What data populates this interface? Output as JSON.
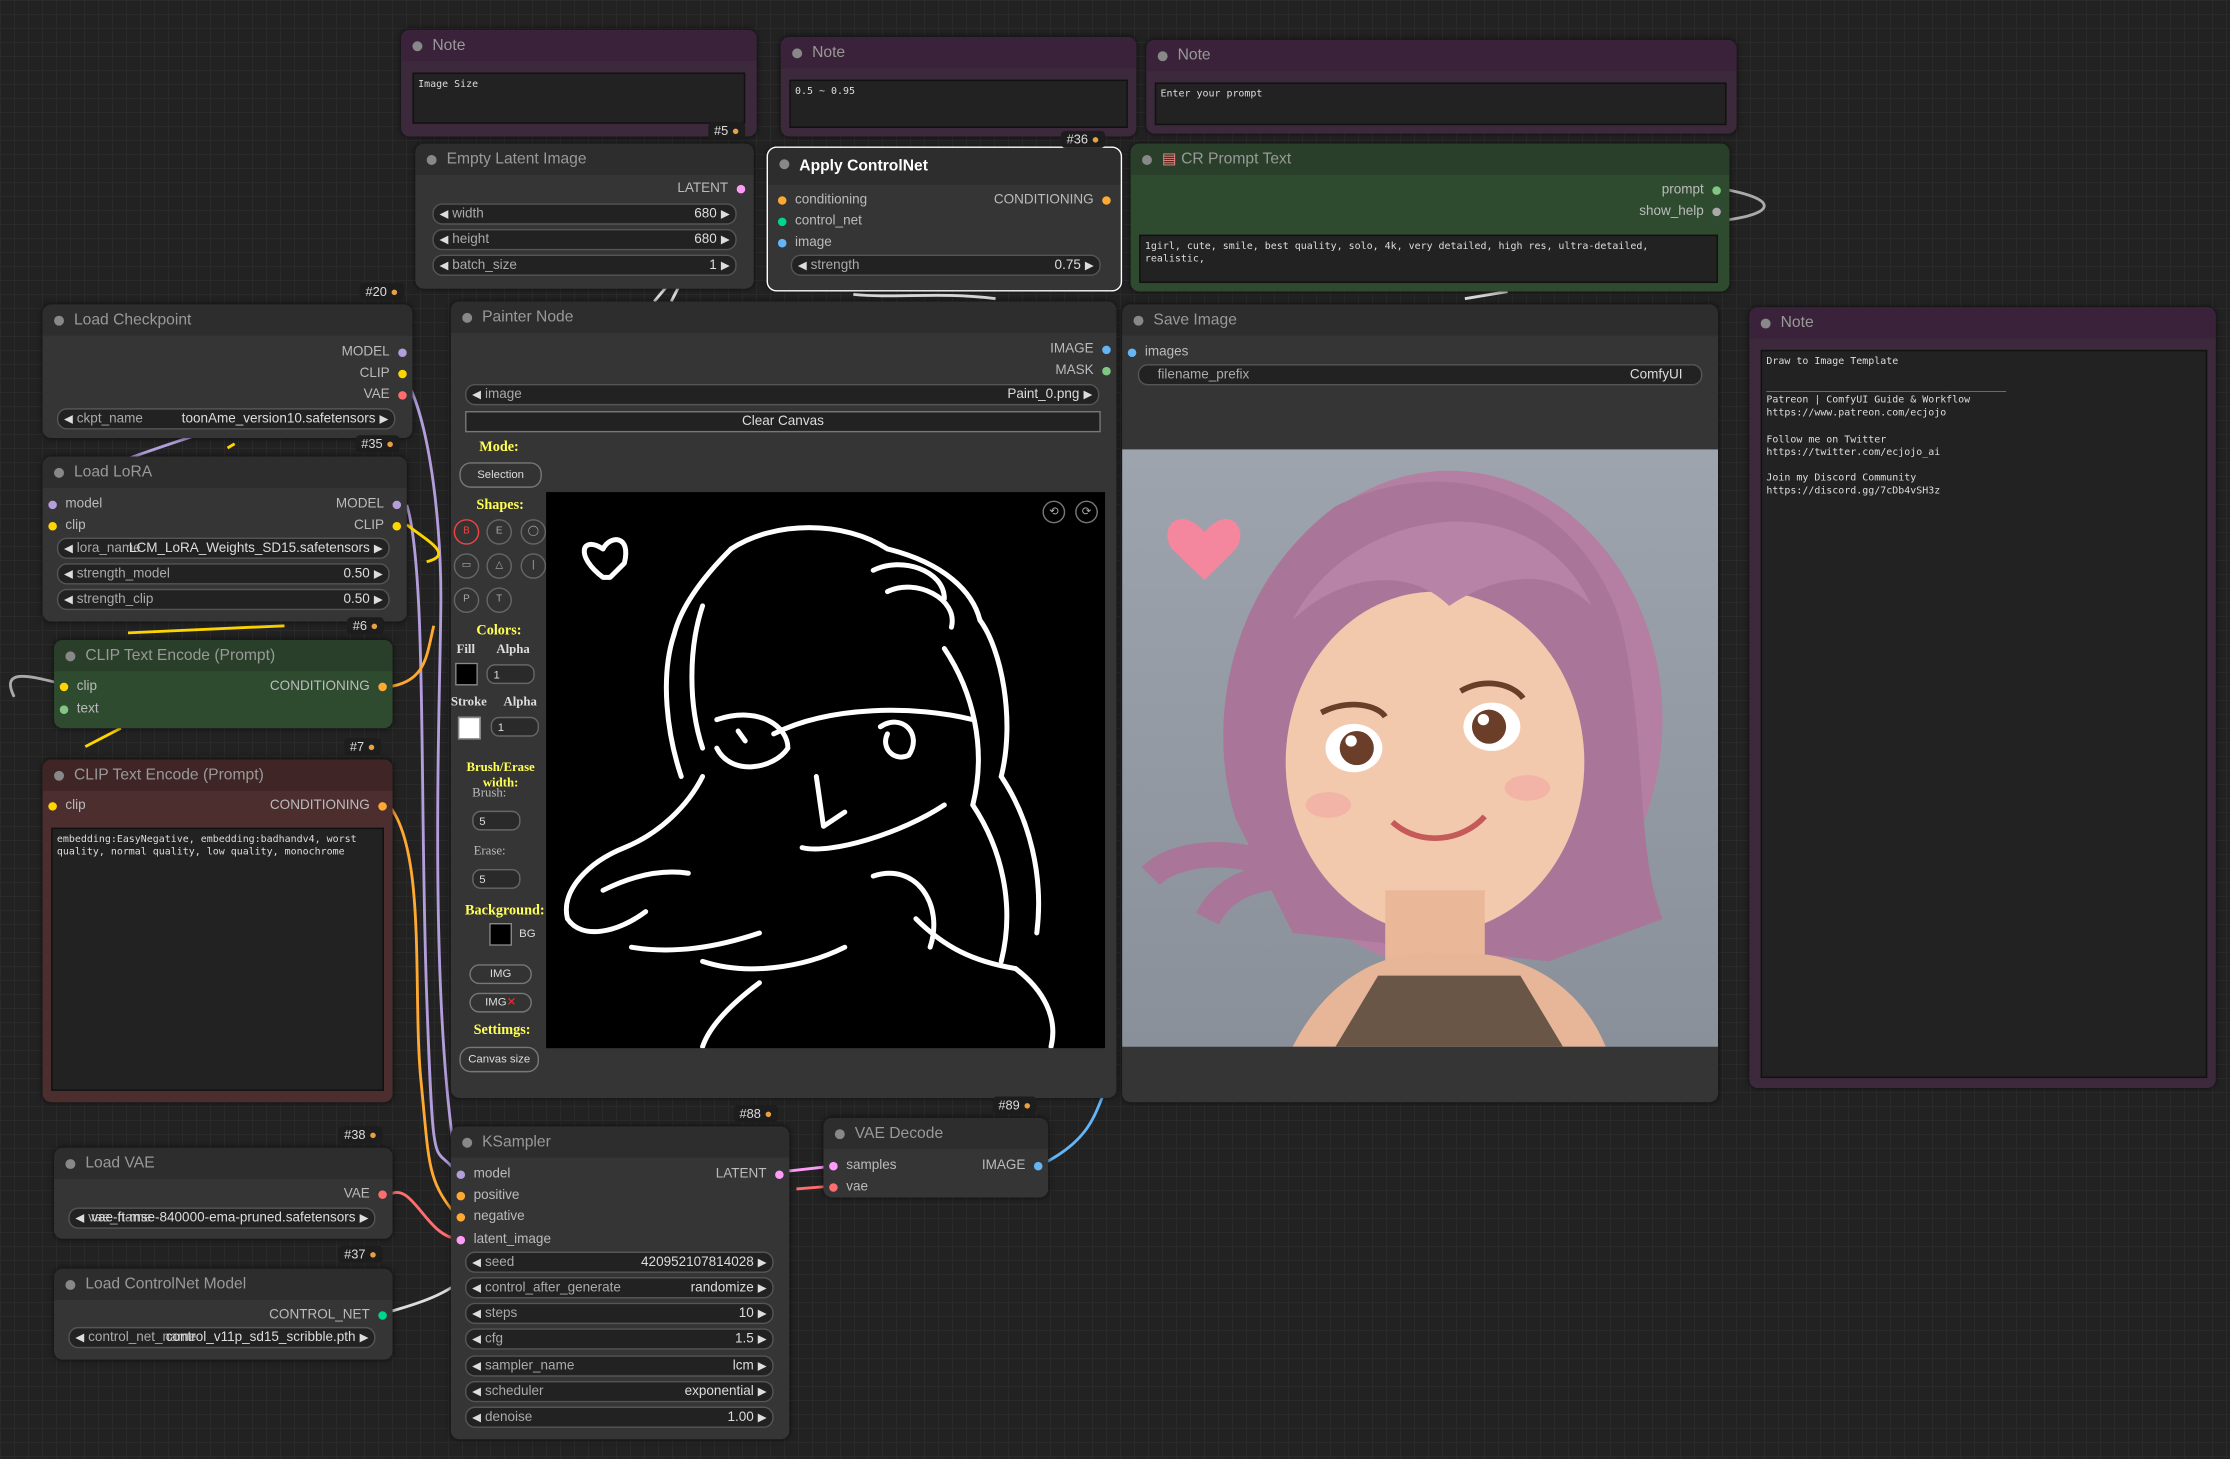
{
  "notes": {
    "n1": {
      "title": "Note",
      "text": "Image Size",
      "badge": "#5"
    },
    "n2": {
      "title": "Note",
      "text": "0.5 ~ 0.95"
    },
    "n3": {
      "title": "Note",
      "text": "Enter your prompt"
    },
    "n4": {
      "title": "Note",
      "text": "Draw to Image Template\n\n________________________________________\nPatreon | ComfyUI Guide & Workflow\nhttps://www.patreon.com/ecjojo\n\nFollow me on Twitter\nhttps://twitter.com/ecjojo_ai\n\nJoin my Discord Community\nhttps://discord.gg/7cDb4vSH3z"
    }
  },
  "empty_latent": {
    "title": "Empty Latent Image",
    "out": "LATENT",
    "width_label": "width",
    "width": "680",
    "height_label": "height",
    "height": "680",
    "batch_label": "batch_size",
    "batch": "1",
    "badge": "#20"
  },
  "apply_cn": {
    "title": "Apply ControlNet",
    "in1": "conditioning",
    "in2": "control_net",
    "in3": "image",
    "out": "CONDITIONING",
    "strength_label": "strength",
    "strength": "0.75",
    "badge": "#36"
  },
  "cr_prompt": {
    "title": "CR Prompt Text",
    "out1": "prompt",
    "out2": "show_help",
    "text": "1girl, cute, smile, best quality, solo, 4k, very detailed, high res, ultra-detailed, realistic,"
  },
  "checkpoint": {
    "title": "Load Checkpoint",
    "out1": "MODEL",
    "out2": "CLIP",
    "out3": "VAE",
    "ckpt_label": "ckpt_name",
    "ckpt": "toonAme_version10.safetensors",
    "badge": "#35"
  },
  "lora": {
    "title": "Load LoRA",
    "in1": "model",
    "in2": "clip",
    "out1": "MODEL",
    "out2": "CLIP",
    "lora_label": "lora_name",
    "lora": "LCM_LoRA_Weights_SD15.safetensors",
    "sm_label": "strength_model",
    "sm": "0.50",
    "sc_label": "strength_clip",
    "sc": "0.50",
    "badge": "#6"
  },
  "clip_pos": {
    "title": "CLIP Text Encode (Prompt)",
    "in1": "clip",
    "in2": "text",
    "out": "CONDITIONING",
    "badge": "#7"
  },
  "clip_neg": {
    "title": "CLIP Text Encode (Prompt)",
    "in1": "clip",
    "out": "CONDITIONING",
    "text": "embedding:EasyNegative, embedding:badhandv4, worst quality, normal quality, low quality, monochrome"
  },
  "painter": {
    "title": "Painter Node",
    "out1": "IMAGE",
    "out2": "MASK",
    "image_label": "image",
    "image": "Paint_0.png",
    "clear": "Clear Canvas",
    "mode": "Mode:",
    "selection": "Selection",
    "shapes": "Shapes:",
    "shape_btns": [
      "B",
      "E",
      "◯",
      "▭",
      "△",
      "|",
      "P",
      "T"
    ],
    "colors": "Colors:",
    "fill": "Fill",
    "alpha": "Alpha",
    "stroke": "Stroke",
    "fill_alpha": "1",
    "stroke_alpha": "1",
    "brush_erase": "Brush/Erase width:",
    "brush": "Brush:",
    "brush_val": "5",
    "erase": "Erase:",
    "erase_val": "5",
    "background": "Background:",
    "bg": "BG",
    "img": "IMG",
    "img_x": "IMG",
    "settings": "Settimgs:",
    "canvas_size": "Canvas size",
    "badge": "#88"
  },
  "save": {
    "title": "Save Image",
    "in1": "images",
    "prefix_label": "filename_prefix",
    "prefix": "ComfyUI",
    "badge": "#89"
  },
  "vae": {
    "title": "Load VAE",
    "out": "VAE",
    "vae_label": "vae_name",
    "vae": "vae-ft-mse-840000-ema-pruned.safetensors",
    "badge": "#38"
  },
  "cn_model": {
    "title": "Load ControlNet Model",
    "out": "CONTROL_NET",
    "label": "control_net_name",
    "value": "control_v11p_sd15_scribble.pth",
    "badge": "#37"
  },
  "ksampler": {
    "title": "KSampler",
    "in1": "model",
    "in2": "positive",
    "in3": "negative",
    "in4": "latent_image",
    "out": "LATENT",
    "widgets": [
      {
        "label": "seed",
        "value": "420952107814028"
      },
      {
        "label": "control_after_generate",
        "value": "randomize"
      },
      {
        "label": "steps",
        "value": "10"
      },
      {
        "label": "cfg",
        "value": "1.5"
      },
      {
        "label": "sampler_name",
        "value": "lcm"
      },
      {
        "label": "scheduler",
        "value": "exponential"
      },
      {
        "label": "denoise",
        "value": "1.00"
      }
    ]
  },
  "vae_decode": {
    "title": "VAE Decode",
    "in1": "samples",
    "in2": "vae",
    "out": "IMAGE"
  },
  "colors": {
    "model": "#b39ddb",
    "clip": "#ffd500",
    "vae": "#ff6e6e",
    "latent": "#ff9cf9",
    "cond": "#ffa931",
    "image": "#64b5f6",
    "cn": "#00d78d",
    "mask": "#81c784"
  }
}
